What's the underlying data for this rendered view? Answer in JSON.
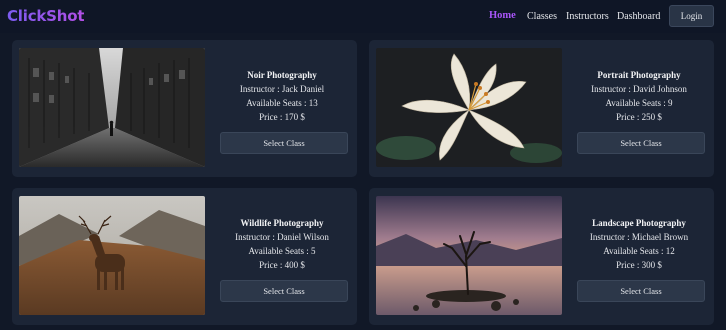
{
  "brand": {
    "logo": "ClickShot"
  },
  "nav": {
    "home": "Home",
    "classes": "Classes",
    "instructors": "Instructors",
    "dashboard": "Dashboard",
    "login": "Login"
  },
  "colors": {
    "page_bg": "#111827",
    "card_bg": "#1c2536",
    "accent": "#a855f7",
    "button_bg": "#2c3749"
  },
  "classes": [
    {
      "title": "Noir Photography",
      "instructor": "Instructor : Jack Daniel",
      "seats": "Available Seats : 13",
      "price": "Price : 170 $",
      "button": "Select Class",
      "image": "noir-alley-photo"
    },
    {
      "title": "Portrait Photography",
      "instructor": "Instructor : David Johnson",
      "seats": "Available Seats : 9",
      "price": "Price : 250 $",
      "button": "Select Class",
      "image": "lily-flower-photo"
    },
    {
      "title": "Wildlife Photography",
      "instructor": "Instructor : Daniel Wilson",
      "seats": "Available Seats : 5",
      "price": "Price : 400 $",
      "button": "Select Class",
      "image": "deer-highlands-photo"
    },
    {
      "title": "Landscape Photography",
      "instructor": "Instructor : Michael Brown",
      "seats": "Available Seats : 12",
      "price": "Price : 300 $",
      "button": "Select Class",
      "image": "lake-tree-photo"
    }
  ]
}
